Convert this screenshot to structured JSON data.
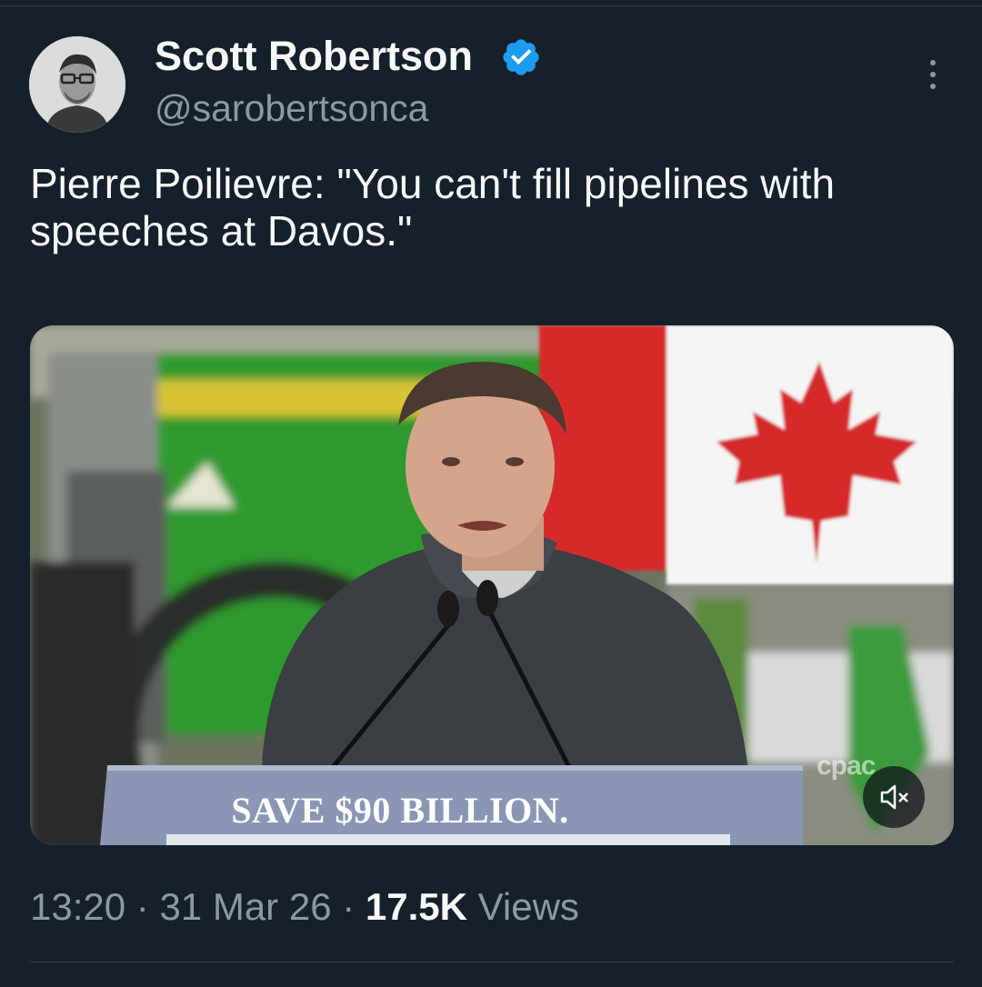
{
  "author": {
    "display_name": "Scott Robertson",
    "handle": "@sarobertsonca",
    "verified": true
  },
  "tweet": {
    "text": "Pierre Poilievre: \"You can't fill pipelines with speeches at Davos.\""
  },
  "media": {
    "podium_text": "SAVE $90 BILLION.",
    "watermark": "cpac",
    "muted": true
  },
  "meta": {
    "time": "13:20",
    "date": "31 Mar 26",
    "separator": "·",
    "views_count": "17.5K",
    "views_label": "Views"
  },
  "icons": {
    "verified": "verified-badge-icon",
    "more": "more-options-icon",
    "mute": "volume-muted-icon"
  },
  "colors": {
    "background": "#15202b",
    "text_primary": "#f7f9f9",
    "text_secondary": "#8b98a5",
    "verified_blue": "#1d9bf0",
    "divider": "#2f3b47"
  }
}
